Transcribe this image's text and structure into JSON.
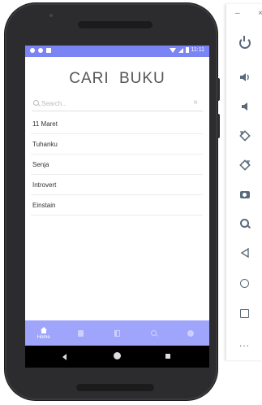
{
  "status_bar": {
    "time": "11:11"
  },
  "app": {
    "title": "CARI   BUKU",
    "search": {
      "placeholder": "Search..",
      "value": "",
      "clear_label": "×"
    },
    "books": [
      "11 Maret",
      "Tuhanku",
      "Senja",
      "Introvert",
      "Einstain"
    ],
    "bottom_nav": {
      "active": "home",
      "home_label": "Home"
    }
  },
  "emulator_panel": {
    "minimize_label": "–",
    "close_label": "×",
    "more_label": "..."
  },
  "colors": {
    "primary": "#7b84f5",
    "nav": "#9ea5fb"
  }
}
